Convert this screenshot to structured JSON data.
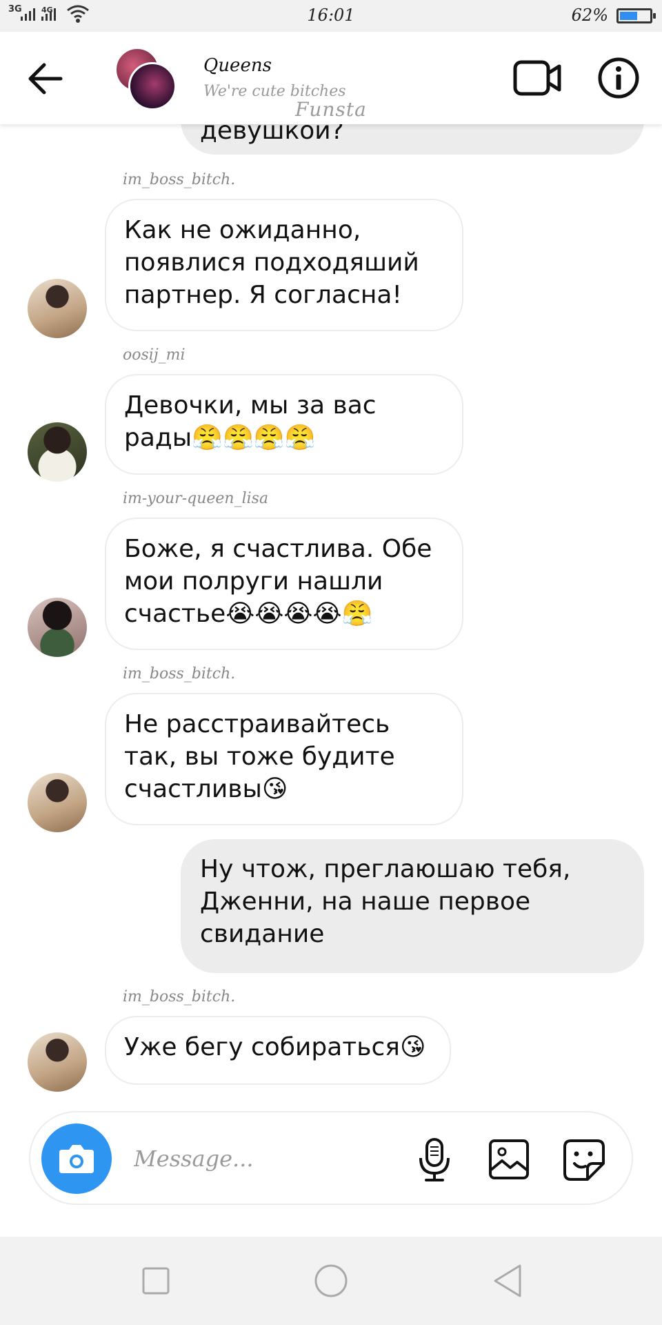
{
  "status_bar": {
    "network_1": "3G",
    "network_2": "4G",
    "time": "16:01",
    "battery": "62%",
    "battery_level": 0.62
  },
  "header": {
    "title": "Queens",
    "subtitle": "We're cute bitches",
    "watermark": "Funsta"
  },
  "messages": [
    {
      "sender": "im_boss_bitch.",
      "text": "Как не ожиданно, появлися подходяший партнер. Я согласна!"
    },
    {
      "sender": "oosij_mi",
      "text": "Девочки, мы за вас рады😤😤😤😤"
    },
    {
      "sender": "im-your-queen_lisa",
      "text": "Боже, я счастлива. Обе мои полруги нашли счастье😭😭😭😭😤"
    },
    {
      "sender": "im_boss_bitch.",
      "text": "Не расстраивайтесь так, вы тоже будите счастливы😘"
    },
    {
      "text": "Ну чтож, преглаюшаю тебя, Дженни, на наше первое свидание"
    },
    {
      "sender": "im_boss_bitch.",
      "text": "Уже бегу собираться😘"
    }
  ],
  "partial_message": "девушкой?",
  "composer": {
    "placeholder": "Message..."
  },
  "colors": {
    "accent": "#2e95f0",
    "incoming_bubble": "#ffffff",
    "outgoing_bubble": "#ececec",
    "header_bg": "#ffffff",
    "nav_bg": "#f2f2f2"
  },
  "icons": {
    "back": "arrow-left-icon",
    "video": "video-camera-icon",
    "info": "info-icon",
    "camera": "camera-icon",
    "mic": "microphone-icon",
    "gallery": "image-icon",
    "sticker": "sticker-icon",
    "nav_recent": "square-icon",
    "nav_home": "circle-icon",
    "nav_back": "triangle-back-icon"
  }
}
